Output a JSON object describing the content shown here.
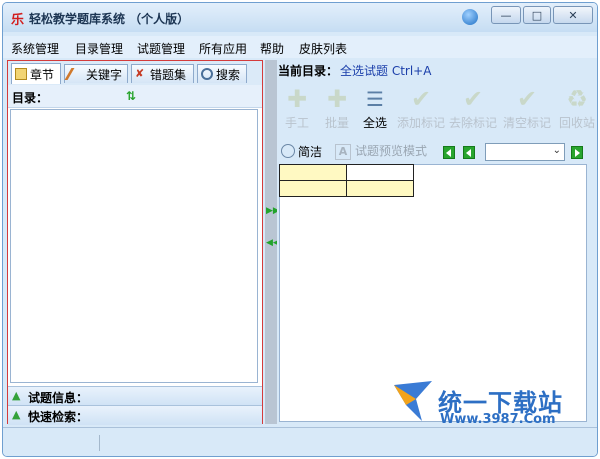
{
  "window": {
    "app_logo": "乐",
    "title": "轻松教学题库系统 （个人版）",
    "controls": {
      "minimize": "—",
      "maximize": "□",
      "close": "✕"
    },
    "skin_icon": "skin-icon"
  },
  "menu": [
    "系统管理",
    "目录管理",
    "试题管理",
    "所有应用",
    "帮助",
    "皮肤列表"
  ],
  "left": {
    "tabs": [
      {
        "label": "章节",
        "icon": "book-icon"
      },
      {
        "label": "关键字",
        "icon": "pencil-icon"
      },
      {
        "label": "错题集",
        "icon": "wrong-icon"
      },
      {
        "label": "搜索",
        "icon": "magnifier-icon"
      }
    ],
    "dir_label": "目录：",
    "strips": [
      "试题信息：",
      "快速检索："
    ]
  },
  "right": {
    "current_dir_label": "当前目录：",
    "current_dir_value": "全选试题 Ctrl+A",
    "toolbar": [
      {
        "label": "手工",
        "icon": "manual-add-icon",
        "enabled": false
      },
      {
        "label": "批量",
        "icon": "batch-add-icon",
        "enabled": false
      },
      {
        "label": "全选",
        "icon": "select-all-icon",
        "enabled": true
      },
      {
        "label": "添加标记",
        "icon": "add-mark-icon",
        "enabled": false
      },
      {
        "label": "去除标记",
        "icon": "remove-mark-icon",
        "enabled": false
      },
      {
        "label": "清空标记",
        "icon": "clear-mark-icon",
        "enabled": false
      },
      {
        "label": "回收站",
        "icon": "recycle-bin-icon",
        "enabled": false
      }
    ],
    "simple_label": "简洁",
    "preview_label": "试题预览模式",
    "preview_icon_letter": "A",
    "colors": {
      "cell_yellow": "#fff9c2"
    }
  },
  "watermark": {
    "text": "统一下载站",
    "url": "Www.3987.Com"
  }
}
